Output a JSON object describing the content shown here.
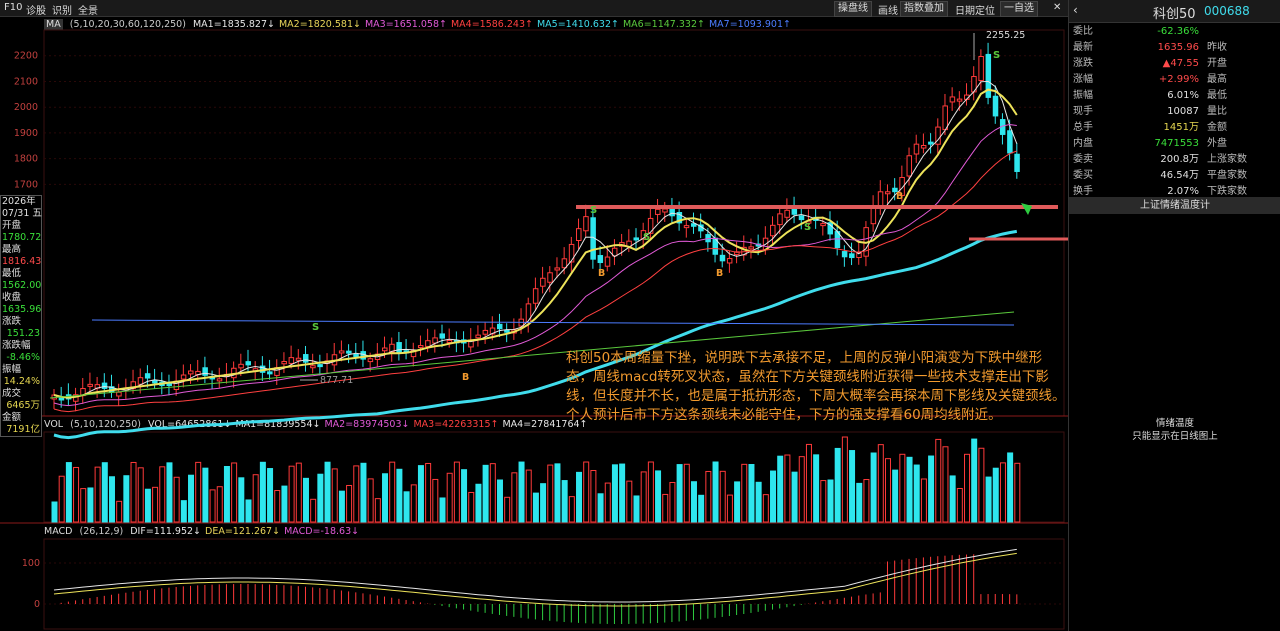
{
  "toolbar": {
    "nav": [
      "F10",
      "诊股",
      "识别",
      "全景"
    ],
    "buttons": [
      "操盘线",
      "画线",
      "指数叠加",
      "日期定位",
      "一自选"
    ],
    "close_label": "✕"
  },
  "ma_line": {
    "label": "MA",
    "params": "(5,10,20,30,60,120,250)",
    "items": [
      {
        "text": "MA1=1835.827↓",
        "color": "#e6e6e6"
      },
      {
        "text": "MA2=1820.581↓",
        "color": "#e8d45a"
      },
      {
        "text": "MA3=1651.058↑",
        "color": "#e05ad6"
      },
      {
        "text": "MA4=1586.243↑",
        "color": "#ff4040"
      },
      {
        "text": "MA5=1410.632↑",
        "color": "#40dcec"
      },
      {
        "text": "MA6=1147.332↑",
        "color": "#5ac83c"
      },
      {
        "text": "MA7=1093.901↑",
        "color": "#4c7cff"
      }
    ]
  },
  "vol_line": {
    "label": "VOL",
    "params": "(5,10,120,250)",
    "items": [
      {
        "text": "VOL=64652861↓",
        "color": "#e6e6e6"
      },
      {
        "text": "MA1=81839554↓",
        "color": "#e6e6e6"
      },
      {
        "text": "MA2=83974503↓",
        "color": "#e05ad6"
      },
      {
        "text": "MA3=42263315↑",
        "color": "#ff4040"
      },
      {
        "text": "MA4=27841764↑",
        "color": "#e6e6e6"
      }
    ]
  },
  "macd_line": {
    "label": "MACD",
    "params": "(26,12,9)",
    "items": [
      {
        "text": "DIF=111.952↓",
        "color": "#e6e6e6"
      },
      {
        "text": "DEA=121.267↓",
        "color": "#e8d45a"
      },
      {
        "text": "MACD=-18.63↓",
        "color": "#e05ad6"
      }
    ]
  },
  "price_axis": [
    "2200",
    "2100",
    "2000",
    "1900",
    "1800",
    "1700"
  ],
  "macd_axis": [
    "100",
    "0"
  ],
  "annotations": {
    "high": "2255.25",
    "low": "877.71",
    "s_marks": [
      "S",
      "S",
      "S",
      "S",
      "S",
      "S"
    ],
    "b_marks": [
      "B",
      "B",
      "B",
      "B"
    ]
  },
  "tooltip": [
    {
      "text": "2026年",
      "cls": "wht"
    },
    {
      "text": "07/31 五",
      "cls": "wht"
    },
    {
      "text": "开盘",
      "cls": "wht"
    },
    {
      "text": "1780.72",
      "cls": "grn"
    },
    {
      "text": "最高",
      "cls": "wht"
    },
    {
      "text": "1816.43",
      "cls": "red"
    },
    {
      "text": "最低",
      "cls": "wht"
    },
    {
      "text": "1562.00",
      "cls": "grn"
    },
    {
      "text": "收盘",
      "cls": "wht"
    },
    {
      "text": "1635.96",
      "cls": "grn"
    },
    {
      "text": "涨跌",
      "cls": "wht"
    },
    {
      "text": "151.23",
      "cls": "grn"
    },
    {
      "text": "涨跌幅",
      "cls": "wht"
    },
    {
      "text": "-8.46%",
      "cls": "grn"
    },
    {
      "text": "振幅",
      "cls": "wht"
    },
    {
      "text": "14.24%",
      "cls": "yel"
    },
    {
      "text": "成交",
      "cls": "wht"
    },
    {
      "text": "6465万",
      "cls": "yel"
    },
    {
      "text": "金额",
      "cls": "wht"
    },
    {
      "text": "7191亿",
      "cls": "yel"
    }
  ],
  "note": "科创50本周缩量下挫，说明跌下去承接不足，上周的反弹小阳演变为下跌中继形态，周线macd转死叉状态，虽然在下方关键颈线附近获得一些技术支撑走出下影线，但长度并不长，也是属于抵抗形态，下周大概率会再探本周下影线及关键颈线。个人预计后市下方这条颈线未必能守住，下方的强支撑看60周均线附近。",
  "quote": {
    "name": "科创50",
    "code": "000688",
    "rows": [
      {
        "k": "委比",
        "v": "-62.36%",
        "vc": "grn",
        "k2": ""
      },
      {
        "k": "最新",
        "v": "1635.96",
        "vc": "red",
        "k2": "昨收"
      },
      {
        "k": "涨跌",
        "v": "▲47.55",
        "vc": "red",
        "k2": "开盘"
      },
      {
        "k": "涨幅",
        "v": "+2.99%",
        "vc": "red",
        "k2": "最高"
      },
      {
        "k": "振幅",
        "v": "6.01%",
        "vc": "wht",
        "k2": "最低"
      },
      {
        "k": "现手",
        "v": "10087",
        "vc": "wht",
        "k2": "量比"
      },
      {
        "k": "总手",
        "v": "1451万",
        "vc": "yel",
        "k2": "金额"
      },
      {
        "k": "内盘",
        "v": "7471553",
        "vc": "grn",
        "k2": "外盘"
      },
      {
        "k": "委卖",
        "v": "200.8万",
        "vc": "wht",
        "k2": "上涨家数"
      },
      {
        "k": "委买",
        "v": "46.54万",
        "vc": "wht",
        "k2": "平盘家数"
      },
      {
        "k": "换手",
        "v": "2.07%",
        "vc": "wht",
        "k2": "下跌家数"
      }
    ],
    "sentiment_title": "上证情绪温度计",
    "sentiment_label": "情绪温度",
    "sentiment_note": "只能显示在日线图上"
  },
  "chart_data": {
    "type": "candlestick",
    "price_range": [
      1520,
      2300
    ],
    "high": 2255.25,
    "low": 877.71,
    "last_close": 1635.96,
    "macd": {
      "dif": 111.952,
      "dea": 121.267,
      "macd": -18.63
    }
  }
}
